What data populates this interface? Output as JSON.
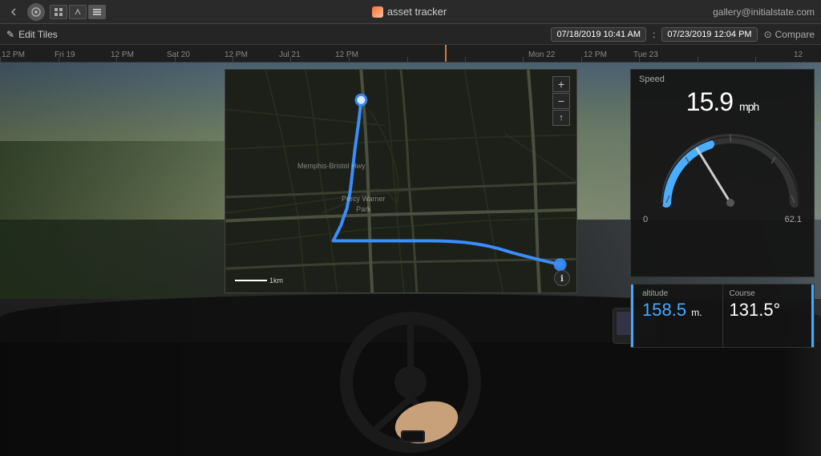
{
  "topbar": {
    "app_title": "asset tracker",
    "user_email": "gallery@initialstate.com",
    "back_icon": "←",
    "logo_icon": "◎",
    "grid_icon": "⊞",
    "signal_icon": "⚡",
    "list_icon": "☰"
  },
  "editbar": {
    "edit_label": "Edit Tiles",
    "pencil_icon": "✎",
    "date_start": "07/18/2019 10:41 AM",
    "date_end": "07/23/2019 12:04 PM",
    "date_separator": ":",
    "compare_icon": "⊙",
    "compare_label": "Compare"
  },
  "timeline": {
    "labels": [
      "12 PM",
      "Fri 19",
      "12 PM",
      "Sat 20",
      "12 PM",
      "Jul 21",
      "12 PM",
      "Mon 22",
      "12 PM",
      "Tue 23",
      "12"
    ],
    "positions": [
      0,
      7,
      14,
      21,
      28,
      36,
      43,
      65,
      72,
      80,
      87
    ]
  },
  "map": {
    "label_percy": "Percy Warner\nPark",
    "label_road": "Memphis-Bristol Hwy",
    "scale_label": "1km",
    "zoom_plus": "+",
    "zoom_minus": "−",
    "compass": "↑",
    "info_icon": "ℹ"
  },
  "speed": {
    "title": "Speed",
    "value": "15.9",
    "unit": "mph",
    "gauge_min": "0",
    "gauge_max": "62.1"
  },
  "altitude": {
    "label": "altitude",
    "value": "158.5",
    "unit": "m."
  },
  "course": {
    "label": "Course",
    "value": "131.5°"
  }
}
